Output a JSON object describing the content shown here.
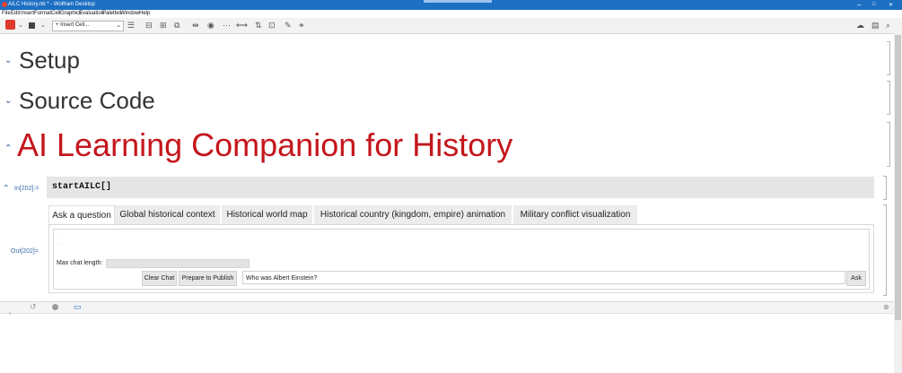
{
  "window": {
    "title": "AILC History.nb * - Wolfram Desktop",
    "minimize": "–",
    "maximize": "□",
    "close": "✕"
  },
  "menu": [
    "File",
    "Edit",
    "Insert",
    "Format",
    "Cell",
    "Graphics",
    "Evaluation",
    "Palettes",
    "Window",
    "Help"
  ],
  "toolbar": {
    "insert_cell": "+ Insert Cell...",
    "icons": [
      "cell-bracket-icon",
      "stop-icon",
      "chevron-down-icon",
      "list-icon",
      "group-icon",
      "ungroup-icon",
      "merge-icon",
      "record-icon",
      "ellipsis-icon",
      "input-output-icon",
      "sort-icon",
      "text-cell-icon",
      "pen-icon",
      "link-icon",
      "cloud-icon",
      "notebook-icon",
      "search-icon"
    ]
  },
  "sections": {
    "setup": "Setup",
    "source": "Source Code",
    "main": "AI Learning Companion for History"
  },
  "input_cell": {
    "label": "In[202]:=",
    "code": "startAILC[]"
  },
  "output_cell": {
    "label": "Out[202]="
  },
  "tabs": [
    {
      "label": "Ask a question",
      "active": true
    },
    {
      "label": "Global historical context",
      "active": false
    },
    {
      "label": "Historical world map",
      "active": false
    },
    {
      "label": "Historical country (kingdom, empire) animation",
      "active": false
    },
    {
      "label": "Military conflict visualization",
      "active": false
    }
  ],
  "panel": {
    "max_chat_label": "Max chat length:",
    "clear_button": "Clear Chat",
    "publish_button": "Prepare to Publish",
    "question_value": "Who was Albert Einstein?",
    "ask_button": "Ask",
    "dots": [
      "·",
      "·"
    ]
  },
  "colors": {
    "titlebar": "#1c6fc3",
    "section_title": "#c4161c",
    "section_heading": "#333333",
    "label_blue": "#3b6aa8"
  }
}
